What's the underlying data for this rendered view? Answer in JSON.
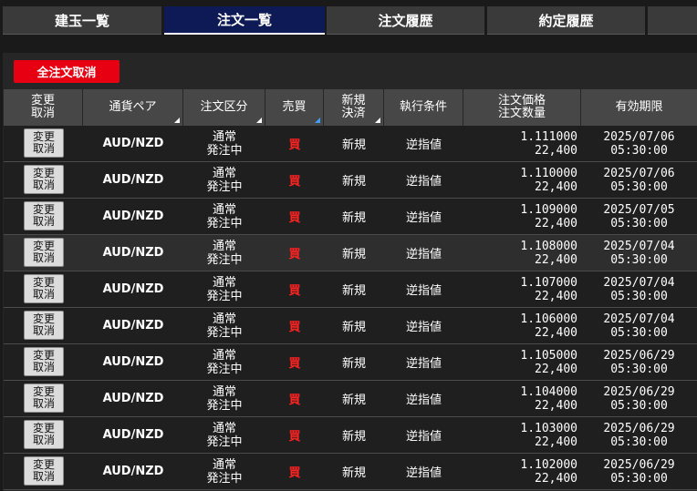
{
  "tabs": [
    {
      "label": "建玉一覧",
      "active": false
    },
    {
      "label": "注文一覧",
      "active": true
    },
    {
      "label": "注文履歴",
      "active": false
    },
    {
      "label": "約定履歴",
      "active": false
    }
  ],
  "cancel_all_label": "全注文取消",
  "headers": {
    "edit_line1": "変更",
    "edit_line2": "取消",
    "pair": "通貨ペア",
    "order_type": "注文区分",
    "side": "売買",
    "new_settle_line1": "新規",
    "new_settle_line2": "決済",
    "exec_condition": "執行条件",
    "price_line1": "注文価格",
    "price_line2": "注文数量",
    "expiry": "有効期限"
  },
  "rows": [
    {
      "edit1": "変更",
      "edit2": "取消",
      "pair": "AUD/NZD",
      "type1": "通常",
      "type2": "発注中",
      "side": "買",
      "newsettle": "新規",
      "cond": "逆指値",
      "price": "1.111000",
      "qty": "22,400",
      "date": "2025/07/06",
      "time": "05:30:00"
    },
    {
      "edit1": "変更",
      "edit2": "取消",
      "pair": "AUD/NZD",
      "type1": "通常",
      "type2": "発注中",
      "side": "買",
      "newsettle": "新規",
      "cond": "逆指値",
      "price": "1.110000",
      "qty": "22,400",
      "date": "2025/07/06",
      "time": "05:30:00"
    },
    {
      "edit1": "変更",
      "edit2": "取消",
      "pair": "AUD/NZD",
      "type1": "通常",
      "type2": "発注中",
      "side": "買",
      "newsettle": "新規",
      "cond": "逆指値",
      "price": "1.109000",
      "qty": "22,400",
      "date": "2025/07/05",
      "time": "05:30:00"
    },
    {
      "edit1": "変更",
      "edit2": "取消",
      "pair": "AUD/NZD",
      "type1": "通常",
      "type2": "発注中",
      "side": "買",
      "newsettle": "新規",
      "cond": "逆指値",
      "price": "1.108000",
      "qty": "22,400",
      "date": "2025/07/04",
      "time": "05:30:00"
    },
    {
      "edit1": "変更",
      "edit2": "取消",
      "pair": "AUD/NZD",
      "type1": "通常",
      "type2": "発注中",
      "side": "買",
      "newsettle": "新規",
      "cond": "逆指値",
      "price": "1.107000",
      "qty": "22,400",
      "date": "2025/07/04",
      "time": "05:30:00"
    },
    {
      "edit1": "変更",
      "edit2": "取消",
      "pair": "AUD/NZD",
      "type1": "通常",
      "type2": "発注中",
      "side": "買",
      "newsettle": "新規",
      "cond": "逆指値",
      "price": "1.106000",
      "qty": "22,400",
      "date": "2025/07/04",
      "time": "05:30:00"
    },
    {
      "edit1": "変更",
      "edit2": "取消",
      "pair": "AUD/NZD",
      "type1": "通常",
      "type2": "発注中",
      "side": "買",
      "newsettle": "新規",
      "cond": "逆指値",
      "price": "1.105000",
      "qty": "22,400",
      "date": "2025/06/29",
      "time": "05:30:00"
    },
    {
      "edit1": "変更",
      "edit2": "取消",
      "pair": "AUD/NZD",
      "type1": "通常",
      "type2": "発注中",
      "side": "買",
      "newsettle": "新規",
      "cond": "逆指値",
      "price": "1.104000",
      "qty": "22,400",
      "date": "2025/06/29",
      "time": "05:30:00"
    },
    {
      "edit1": "変更",
      "edit2": "取消",
      "pair": "AUD/NZD",
      "type1": "通常",
      "type2": "発注中",
      "side": "買",
      "newsettle": "新規",
      "cond": "逆指値",
      "price": "1.103000",
      "qty": "22,400",
      "date": "2025/06/29",
      "time": "05:30:00"
    },
    {
      "edit1": "変更",
      "edit2": "取消",
      "pair": "AUD/NZD",
      "type1": "通常",
      "type2": "発注中",
      "side": "買",
      "newsettle": "新規",
      "cond": "逆指値",
      "price": "1.102000",
      "qty": "22,400",
      "date": "2025/06/29",
      "time": "05:30:00"
    }
  ],
  "colors": {
    "accent_red": "#e60012",
    "active_tab": "#0d1a55",
    "sell_buy_red": "#ff2222"
  }
}
